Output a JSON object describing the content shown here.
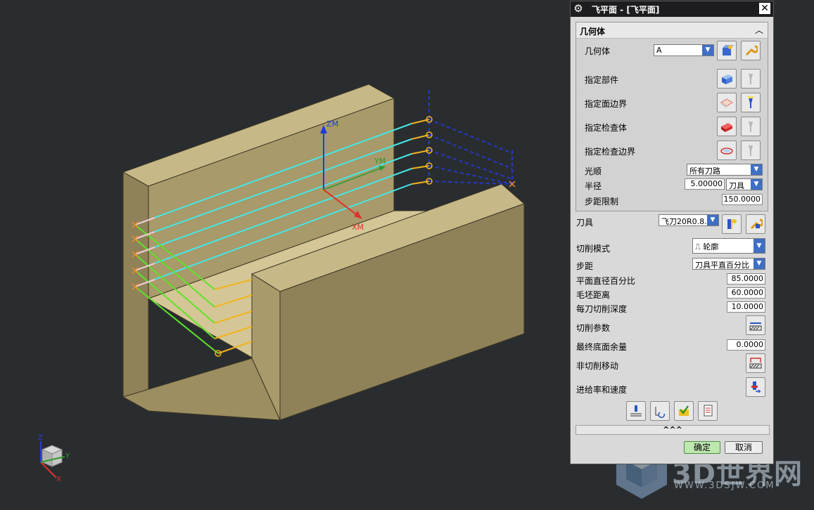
{
  "viewport": {
    "axis_labels": {
      "zm": "ZM",
      "ym": "YM",
      "xm": "XM"
    },
    "triad_labels": {
      "z": "Z",
      "y": "Y",
      "x": "X"
    }
  },
  "dialog": {
    "title": "飞平面 - [飞平面]",
    "geometry_group": {
      "header": "几何体",
      "geometry_label": "几何体",
      "geometry_value": "A",
      "specify_part": "指定部件",
      "specify_face_boundary": "指定面边界",
      "specify_check_body": "指定检查体",
      "specify_check_boundary": "指定检查边界",
      "smoothing_label": "光顺",
      "smoothing_value": "所有刀路",
      "radius_label": "半径",
      "radius_value": "5.00000",
      "radius_unit": "刀具",
      "step_limit_label": "步距限制",
      "step_limit_value": "150.0000"
    },
    "tool_label": "刀具",
    "tool_value": "飞刀20R0.8...",
    "cut_pattern_label": "切削模式",
    "cut_pattern_value": "轮廓",
    "stepover_label": "步距",
    "stepover_value": "刀具平直百分比",
    "flat_diameter_label": "平面直径百分比",
    "flat_diameter_value": "85.0000",
    "blank_distance_label": "毛坯距离",
    "blank_distance_value": "60.0000",
    "depth_per_cut_label": "每刀切削深度",
    "depth_per_cut_value": "10.0000",
    "cutting_params_label": "切削参数",
    "final_floor_stock_label": "最终底面余量",
    "final_floor_stock_value": "0.0000",
    "non_cutting_moves_label": "非切削移动",
    "feeds_speeds_label": "进给率和速度",
    "more_label": "^^^",
    "ok_label": "确定",
    "cancel_label": "取消"
  },
  "watermark": {
    "text": "3D世界网",
    "url": "WWW.3DSJW.COM"
  },
  "colors": {
    "viewport_bg": "#2a2d30",
    "part_face": "#b8aa7c",
    "toolpath_cyan": "#46e6e6",
    "toolpath_yellow": "#f2b31e",
    "toolpath_green": "#5fe22a",
    "accent_blue": "#3f6fc4"
  }
}
